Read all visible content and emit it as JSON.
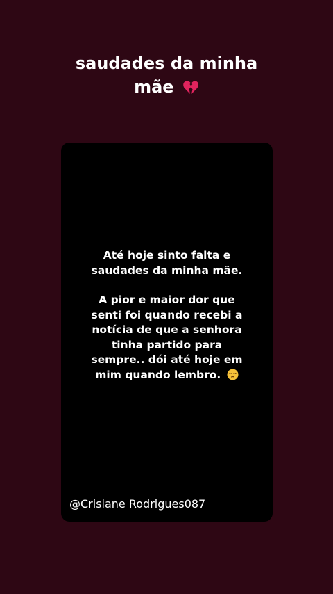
{
  "post": {
    "title_line1": "saudades da minha",
    "title_line2": "mãe",
    "title_icon": "broken-heart-icon"
  },
  "card": {
    "paragraph1": [
      "Até hoje sinto falta e",
      "saudades da minha mãe."
    ],
    "paragraph2": [
      "A pior e maior dor que",
      "senti foi quando recebi a",
      "notícia de que a senhora",
      "tinha partido para",
      "sempre.. dói até hoje em",
      "mim quando lembro."
    ],
    "end_icon": "pensive-face-icon",
    "watermark": "@Crislane Rodrigues087"
  },
  "colors": {
    "background": "#2e0714",
    "card": "#000000",
    "text": "#ffffff",
    "heart": "#e0245e"
  }
}
